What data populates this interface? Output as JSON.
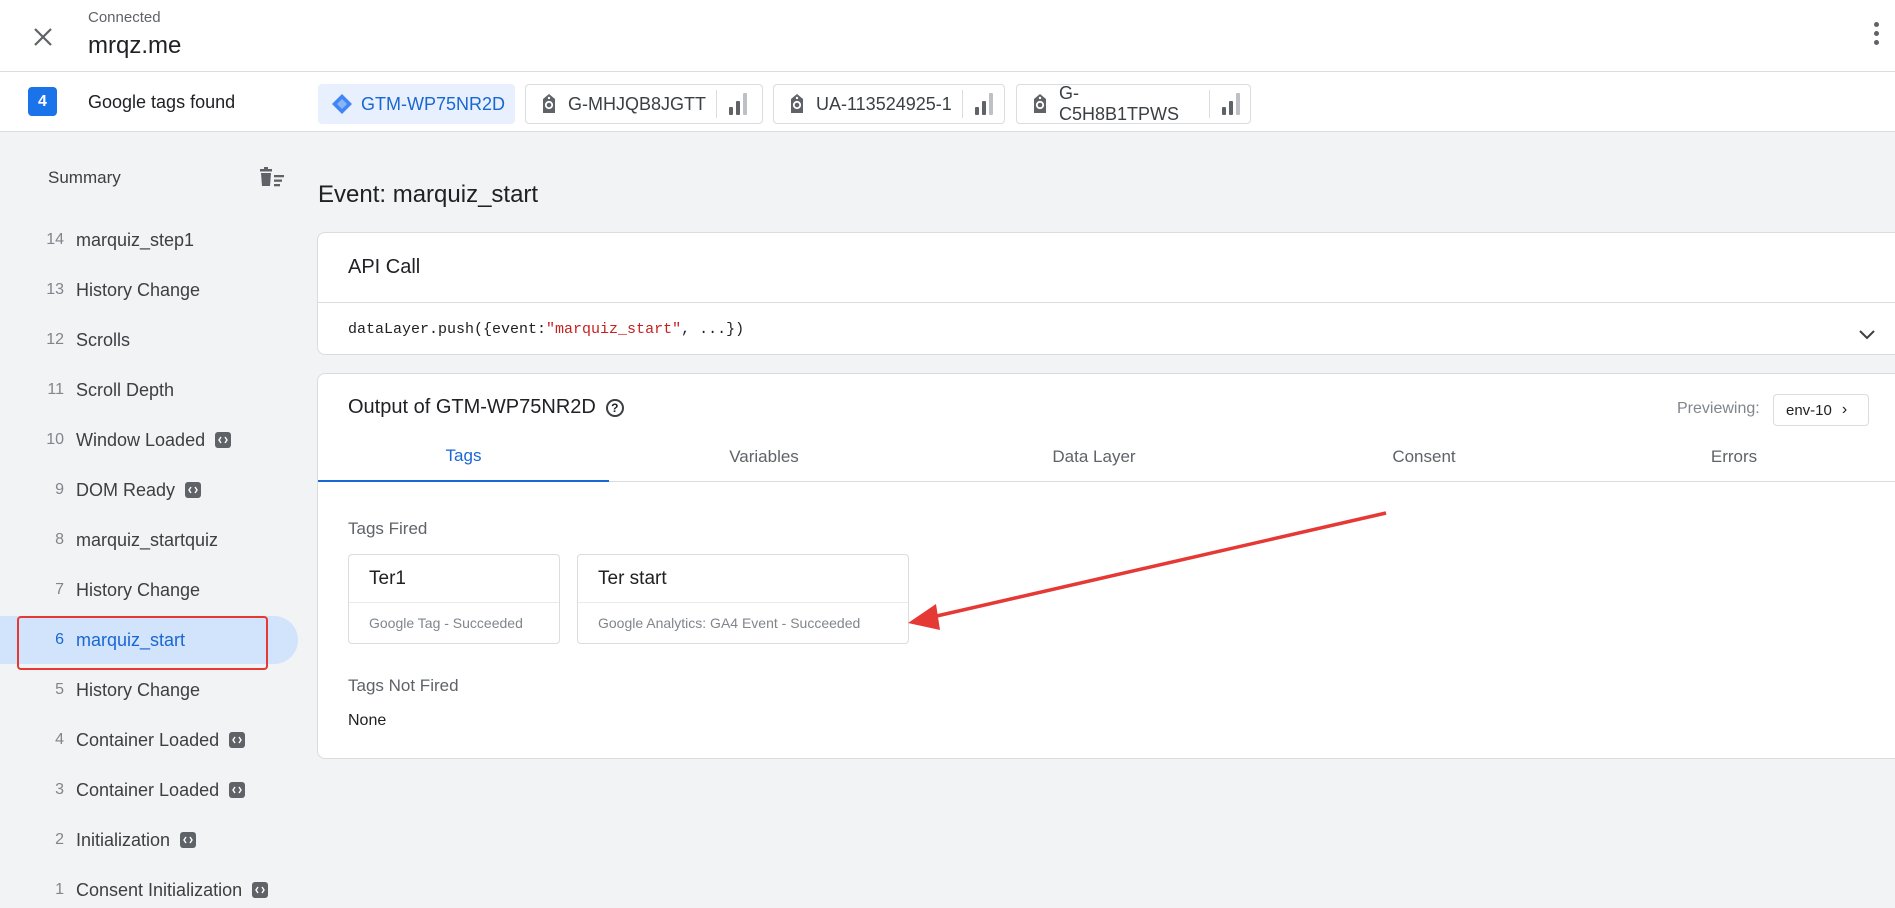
{
  "header": {
    "status": "Connected",
    "site": "mrqz.me"
  },
  "tagsbar": {
    "count": "4",
    "found_label": "Google tags found",
    "chips": [
      {
        "id": "GTM-WP75NR2D"
      },
      {
        "id": "G-MHJQB8JGTT"
      },
      {
        "id": "UA-113524925-1"
      },
      {
        "id": "G-C5H8B1TPWS"
      }
    ]
  },
  "sidebar": {
    "summary": "Summary",
    "events": [
      {
        "num": "14",
        "label": "marquiz_step1"
      },
      {
        "num": "13",
        "label": "History Change"
      },
      {
        "num": "12",
        "label": "Scrolls"
      },
      {
        "num": "11",
        "label": "Scroll Depth"
      },
      {
        "num": "10",
        "label": "Window Loaded"
      },
      {
        "num": "9",
        "label": "DOM Ready"
      },
      {
        "num": "8",
        "label": "marquiz_startquiz"
      },
      {
        "num": "7",
        "label": "History Change"
      },
      {
        "num": "6",
        "label": "marquiz_start"
      },
      {
        "num": "5",
        "label": "History Change"
      },
      {
        "num": "4",
        "label": "Container Loaded"
      },
      {
        "num": "3",
        "label": "Container Loaded"
      },
      {
        "num": "2",
        "label": "Initialization"
      },
      {
        "num": "1",
        "label": "Consent Initialization"
      }
    ]
  },
  "main": {
    "event_title": "Event: marquiz_start",
    "api_call": {
      "title": "API Call",
      "code_prefix": "dataLayer.push({event: ",
      "code_string": "\"marquiz_start\"",
      "code_suffix": ", ...})"
    },
    "output": {
      "title": "Output of GTM-WP75NR2D",
      "help": "?",
      "previewing_label": "Previewing:",
      "env": "env-10",
      "tabs": [
        "Tags",
        "Variables",
        "Data Layer",
        "Consent",
        "Errors"
      ],
      "tags_fired_label": "Tags Fired",
      "tags_fired": [
        {
          "name": "Ter1",
          "status": "Google Tag - Succeeded"
        },
        {
          "name": "Ter start",
          "status": "Google Analytics: GA4 Event - Succeeded"
        }
      ],
      "tags_not_fired_label": "Tags Not Fired",
      "tags_not_fired": "None"
    }
  },
  "colors": {
    "accent": "#1a73e8",
    "selected_bg": "#d2e3fc",
    "annotation": "#e53935"
  }
}
